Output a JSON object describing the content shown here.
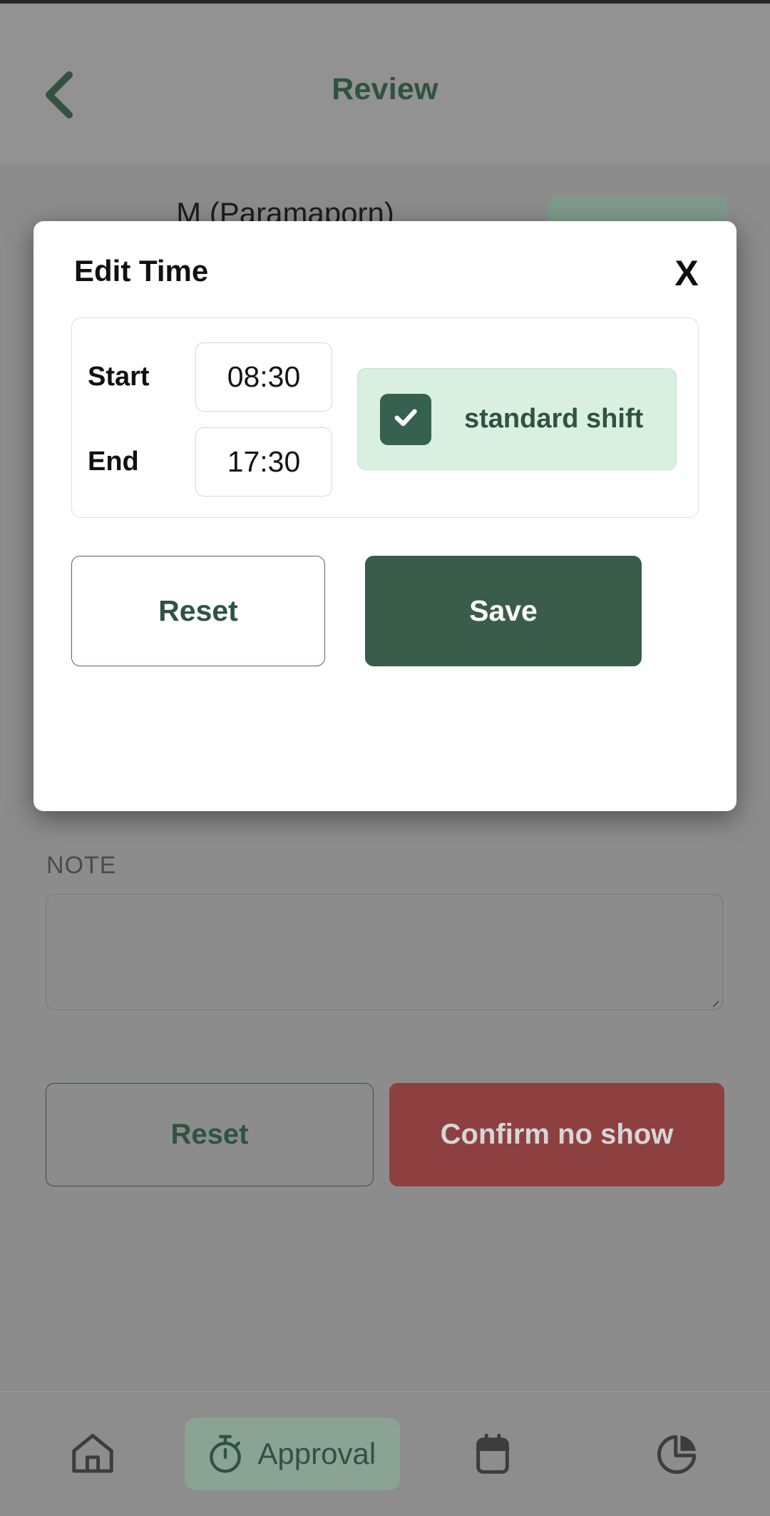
{
  "header": {
    "title": "Review",
    "back_icon": "chevron-left-icon"
  },
  "background": {
    "person_name": "M (Paramaporn)",
    "note_label": "NOTE",
    "note_value": "",
    "note_placeholder": "",
    "reset_label": "Reset",
    "confirm_no_show_label": "Confirm no show"
  },
  "modal": {
    "title": "Edit Time",
    "close_label": "X",
    "start_label": "Start",
    "start_value": "08:30",
    "end_label": "End",
    "end_value": "17:30",
    "shift_label": "standard shift",
    "shift_checked": true,
    "reset_label": "Reset",
    "save_label": "Save"
  },
  "bottom_nav": {
    "items": [
      {
        "label": "",
        "icon": "home-icon",
        "active": false
      },
      {
        "label": "Approval",
        "icon": "stopwatch-icon",
        "active": true
      },
      {
        "label": "",
        "icon": "calendar-icon",
        "active": false
      },
      {
        "label": "",
        "icon": "pie-chart-icon",
        "active": false
      }
    ]
  },
  "colors": {
    "brand_green": "#2f5244",
    "save_green": "#3a5c4b",
    "checkbox_green": "#35614e",
    "shift_panel_green": "#d9f0e0",
    "nav_pill_green": "#8ba395",
    "danger_red": "#8e4040",
    "overlay_gray": "#8c8c8c"
  }
}
